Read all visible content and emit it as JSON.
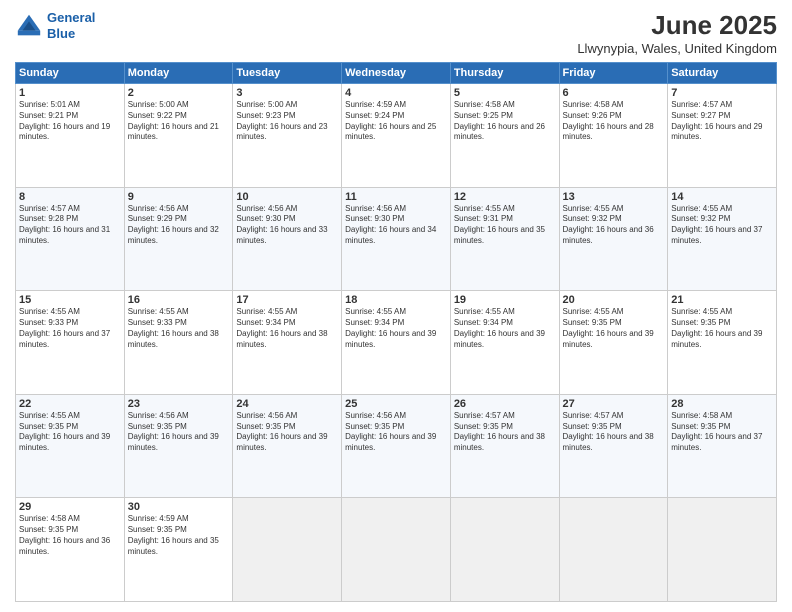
{
  "header": {
    "logo_line1": "General",
    "logo_line2": "Blue",
    "title": "June 2025",
    "subtitle": "Llwynypia, Wales, United Kingdom"
  },
  "weekdays": [
    "Sunday",
    "Monday",
    "Tuesday",
    "Wednesday",
    "Thursday",
    "Friday",
    "Saturday"
  ],
  "weeks": [
    [
      {
        "day": "1",
        "sunrise": "5:01 AM",
        "sunset": "9:21 PM",
        "daylight": "16 hours and 19 minutes."
      },
      {
        "day": "2",
        "sunrise": "5:00 AM",
        "sunset": "9:22 PM",
        "daylight": "16 hours and 21 minutes."
      },
      {
        "day": "3",
        "sunrise": "5:00 AM",
        "sunset": "9:23 PM",
        "daylight": "16 hours and 23 minutes."
      },
      {
        "day": "4",
        "sunrise": "4:59 AM",
        "sunset": "9:24 PM",
        "daylight": "16 hours and 25 minutes."
      },
      {
        "day": "5",
        "sunrise": "4:58 AM",
        "sunset": "9:25 PM",
        "daylight": "16 hours and 26 minutes."
      },
      {
        "day": "6",
        "sunrise": "4:58 AM",
        "sunset": "9:26 PM",
        "daylight": "16 hours and 28 minutes."
      },
      {
        "day": "7",
        "sunrise": "4:57 AM",
        "sunset": "9:27 PM",
        "daylight": "16 hours and 29 minutes."
      }
    ],
    [
      {
        "day": "8",
        "sunrise": "4:57 AM",
        "sunset": "9:28 PM",
        "daylight": "16 hours and 31 minutes."
      },
      {
        "day": "9",
        "sunrise": "4:56 AM",
        "sunset": "9:29 PM",
        "daylight": "16 hours and 32 minutes."
      },
      {
        "day": "10",
        "sunrise": "4:56 AM",
        "sunset": "9:30 PM",
        "daylight": "16 hours and 33 minutes."
      },
      {
        "day": "11",
        "sunrise": "4:56 AM",
        "sunset": "9:30 PM",
        "daylight": "16 hours and 34 minutes."
      },
      {
        "day": "12",
        "sunrise": "4:55 AM",
        "sunset": "9:31 PM",
        "daylight": "16 hours and 35 minutes."
      },
      {
        "day": "13",
        "sunrise": "4:55 AM",
        "sunset": "9:32 PM",
        "daylight": "16 hours and 36 minutes."
      },
      {
        "day": "14",
        "sunrise": "4:55 AM",
        "sunset": "9:32 PM",
        "daylight": "16 hours and 37 minutes."
      }
    ],
    [
      {
        "day": "15",
        "sunrise": "4:55 AM",
        "sunset": "9:33 PM",
        "daylight": "16 hours and 37 minutes."
      },
      {
        "day": "16",
        "sunrise": "4:55 AM",
        "sunset": "9:33 PM",
        "daylight": "16 hours and 38 minutes."
      },
      {
        "day": "17",
        "sunrise": "4:55 AM",
        "sunset": "9:34 PM",
        "daylight": "16 hours and 38 minutes."
      },
      {
        "day": "18",
        "sunrise": "4:55 AM",
        "sunset": "9:34 PM",
        "daylight": "16 hours and 39 minutes."
      },
      {
        "day": "19",
        "sunrise": "4:55 AM",
        "sunset": "9:34 PM",
        "daylight": "16 hours and 39 minutes."
      },
      {
        "day": "20",
        "sunrise": "4:55 AM",
        "sunset": "9:35 PM",
        "daylight": "16 hours and 39 minutes."
      },
      {
        "day": "21",
        "sunrise": "4:55 AM",
        "sunset": "9:35 PM",
        "daylight": "16 hours and 39 minutes."
      }
    ],
    [
      {
        "day": "22",
        "sunrise": "4:55 AM",
        "sunset": "9:35 PM",
        "daylight": "16 hours and 39 minutes."
      },
      {
        "day": "23",
        "sunrise": "4:56 AM",
        "sunset": "9:35 PM",
        "daylight": "16 hours and 39 minutes."
      },
      {
        "day": "24",
        "sunrise": "4:56 AM",
        "sunset": "9:35 PM",
        "daylight": "16 hours and 39 minutes."
      },
      {
        "day": "25",
        "sunrise": "4:56 AM",
        "sunset": "9:35 PM",
        "daylight": "16 hours and 39 minutes."
      },
      {
        "day": "26",
        "sunrise": "4:57 AM",
        "sunset": "9:35 PM",
        "daylight": "16 hours and 38 minutes."
      },
      {
        "day": "27",
        "sunrise": "4:57 AM",
        "sunset": "9:35 PM",
        "daylight": "16 hours and 38 minutes."
      },
      {
        "day": "28",
        "sunrise": "4:58 AM",
        "sunset": "9:35 PM",
        "daylight": "16 hours and 37 minutes."
      }
    ],
    [
      {
        "day": "29",
        "sunrise": "4:58 AM",
        "sunset": "9:35 PM",
        "daylight": "16 hours and 36 minutes."
      },
      {
        "day": "30",
        "sunrise": "4:59 AM",
        "sunset": "9:35 PM",
        "daylight": "16 hours and 35 minutes."
      },
      null,
      null,
      null,
      null,
      null
    ]
  ]
}
